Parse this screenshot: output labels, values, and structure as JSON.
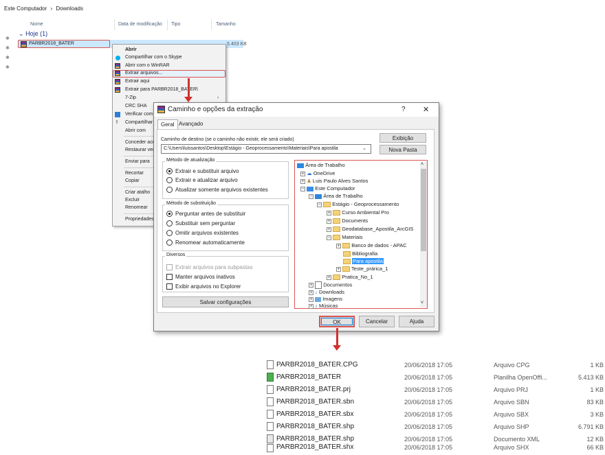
{
  "breadcrumb": {
    "part1": "Este Computador",
    "sep": "›",
    "part2": "Downloads"
  },
  "columns": {
    "name": "Nome",
    "date": "Data de modificação",
    "type": "Tipo",
    "size": "Tamanho"
  },
  "group": {
    "label": "Hoje (1)"
  },
  "selected_file": {
    "name": "PARBR2018_BATER",
    "size_partial": "5.403 KB"
  },
  "context_menu": {
    "items": [
      "Abrir",
      "Compartilhar com o Skype",
      "Abrir com o WinRAR",
      "Extrair arquivos...",
      "Extrair aqui",
      "Extrair para PARBR2018_BATER\\",
      "7-Zip",
      "CRC SHA",
      "Verificar com o",
      "Compartilhar",
      "Abrir com",
      "Conceder aces",
      "Restaurar versõ",
      "Enviar para",
      "Recortar",
      "Copiar",
      "Criar atalho",
      "Excluir",
      "Renomear",
      "Propriedades"
    ],
    "chevron": "›"
  },
  "dialog": {
    "title": "Caminho e opções da extração",
    "help": "?",
    "close": "✕",
    "tabs": [
      "Geral",
      "Avançado"
    ],
    "dest_label": "Caminho de destino (se o caminho não existir, ele será criado)",
    "dest_value": "C:\\Users\\luissantos\\Desktop\\Estágio - Geoprocessamento\\Materiais\\Para apostila",
    "btn_view": "Exibição",
    "btn_new_folder": "Nova Pasta",
    "update_group": {
      "title": "Método de atualização",
      "options": [
        "Extrair e substituir arquivo",
        "Extrair e atualizar arquivo",
        "Atualizar somente arquivos existentes"
      ]
    },
    "overwrite_group": {
      "title": "Método de substituição",
      "options": [
        "Perguntar antes de substituir",
        "Substituir sem perguntar",
        "Omitir arquivos existentes",
        "Renomear automaticamente"
      ]
    },
    "misc_group": {
      "title": "Diversos",
      "options": [
        "Extrair arquivos para subpastas",
        "Manter arquivos inativos",
        "Exibir arquivos no Explorer"
      ]
    },
    "btn_save": "Salvar configurações",
    "tree": [
      "Área de Trabalho",
      "OneDrive",
      "Luis Paulo Alves Santos",
      "Este Computador",
      "Área de Trabalho",
      "Estágio - Geoprocessamento",
      "Curso Ambiental Pro",
      "Documents",
      "Geodatabase_Apostila_ArcGIS",
      "Materiais",
      "Banco de dados - APAC",
      "Bibliografia",
      "Para apostila",
      "Teste_prárica_1",
      "Pratica_No_1",
      "Documentos",
      "Downloads",
      "Imagens",
      "Músicas"
    ],
    "btn_ok": "OK",
    "btn_cancel": "Cancelar",
    "btn_help": "Ajuda"
  },
  "result_files": [
    {
      "name": "PARBR2018_BATER.CPG",
      "date": "20/06/2018 17:05",
      "type": "Arquivo CPG",
      "size": "1 KB"
    },
    {
      "name": "PARBR2018_BATER",
      "date": "20/06/2018 17:05",
      "type": "Planilha OpenOffi...",
      "size": "5.413 KB"
    },
    {
      "name": "PARBR2018_BATER.prj",
      "date": "20/06/2018 17:05",
      "type": "Arquivo PRJ",
      "size": "1 KB"
    },
    {
      "name": "PARBR2018_BATER.sbn",
      "date": "20/06/2018 17:05",
      "type": "Arquivo SBN",
      "size": "83 KB"
    },
    {
      "name": "PARBR2018_BATER.sbx",
      "date": "20/06/2018 17:05",
      "type": "Arquivo SBX",
      "size": "3 KB"
    },
    {
      "name": "PARBR2018_BATER.shp",
      "date": "20/06/2018 17:05",
      "type": "Arquivo SHP",
      "size": "6.791 KB"
    },
    {
      "name": "PARBR2018_BATER.shp",
      "date": "20/06/2018 17:05",
      "type": "Documento XML",
      "size": "12 KB"
    },
    {
      "name": "PARBR2018_BATER.shx",
      "date": "20/06/2018 17:05",
      "type": "Arquivo SHX",
      "size": "66 KB"
    }
  ],
  "colors": {
    "highlight_red": "#d9534f",
    "selection_blue": "#cce8ff",
    "tree_selected": "#3399ff"
  }
}
